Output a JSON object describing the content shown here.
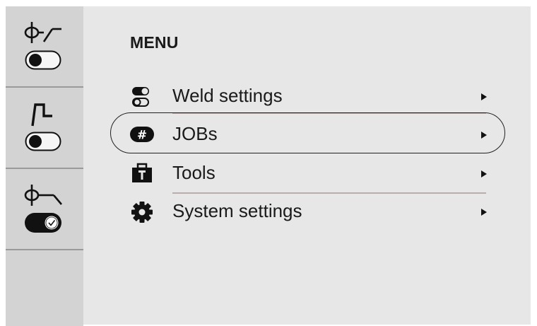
{
  "menu": {
    "title": "MENU",
    "items": [
      {
        "label": "Weld settings",
        "icon": "toggle-settings-icon"
      },
      {
        "label": "JOBs",
        "icon": "hash-tag-icon"
      },
      {
        "label": "Tools",
        "icon": "toolbox-icon"
      },
      {
        "label": "System settings",
        "icon": "gear-icon"
      }
    ],
    "selected_index": 1
  },
  "sidebar": {
    "items": [
      {
        "icon": "process-symbol-rising-icon",
        "toggle_state": "off"
      },
      {
        "icon": "pulse-wave-icon",
        "toggle_state": "off"
      },
      {
        "icon": "process-symbol-falling-icon",
        "toggle_state": "on"
      }
    ]
  },
  "colors": {
    "background": "#e7e7e7",
    "sidebar": "#d3d3d3",
    "text": "#1a1a1a",
    "separator": "#b9aeae"
  }
}
